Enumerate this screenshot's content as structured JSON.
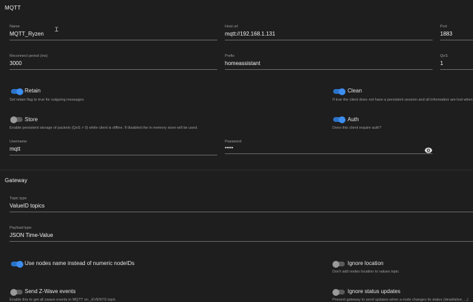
{
  "mqtt": {
    "title": "MQTT",
    "name": {
      "label": "Name",
      "value": "MQTT_Ryzen"
    },
    "host": {
      "label": "Host url",
      "value": "mqtt://192.168.1.131"
    },
    "port": {
      "label": "Port",
      "value": "1883"
    },
    "reconnect": {
      "label": "Reconnect period (ms)",
      "value": "3000"
    },
    "prefix": {
      "label": "Prefix",
      "value": "homeassistant"
    },
    "qos": {
      "label": "QoS",
      "value": "1"
    },
    "retain": {
      "label": "Retain",
      "hint": "Set retain flag to true for outgoing messages",
      "on": true
    },
    "clean": {
      "label": "Clean",
      "hint": "If true the client does not have a persistent session and all information are lost when",
      "on": true
    },
    "store": {
      "label": "Store",
      "hint": "Enable persistent storage of packets (QoS > 0) while client is offline. If disabled the in memory store will be used.",
      "on": false
    },
    "auth": {
      "label": "Auth",
      "hint": "Does this client require auth?",
      "on": true
    },
    "username": {
      "label": "Username",
      "value": "mqtt"
    },
    "password": {
      "label": "Password",
      "value": "•••••"
    }
  },
  "gateway": {
    "title": "Gateway",
    "topic_type": {
      "label": "Topic type",
      "value": "ValueID topics"
    },
    "payload_type": {
      "label": "Payload type",
      "value": "JSON Time-Value"
    },
    "use_nodes_name": {
      "label": "Use nodes name instead of numeric nodeIDs",
      "on": true
    },
    "ignore_location": {
      "label": "Ignore location",
      "hint": "Don't add nodes location to values topic",
      "on": false
    },
    "send_events": {
      "label": "Send Z-Wave events",
      "hint": "Enable this to get all zwave events in MQTT on _EVENTS topic",
      "on": false
    },
    "ignore_status": {
      "label": "Ignore status updates",
      "hint": "Prevent gateway to send updates when a node changes its status (dead/alive, ...)",
      "on": false
    }
  },
  "colors": {
    "accent": "#2b73c9",
    "background": "#1e1e1e"
  }
}
